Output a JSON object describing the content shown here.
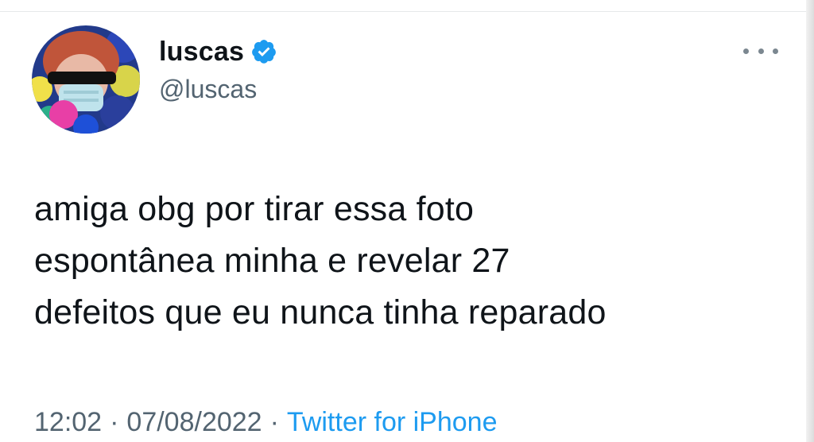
{
  "tweet": {
    "author": {
      "display_name": "luscas",
      "handle": "@luscas",
      "verified": true,
      "avatar_icon": "profile-photo"
    },
    "text": "amiga obg por tirar essa foto\nespontânea minha e revelar 27\ndefeitos que eu nunca tinha reparado",
    "time": "12:02",
    "date": "07/08/2022",
    "separator": "·",
    "source": "Twitter for iPhone",
    "more_icon": "more-horizontal-icon"
  },
  "colors": {
    "primary_text": "#0f1419",
    "secondary_text": "#536471",
    "link": "#1d9bf0",
    "verified_badge": "#1d9bf0"
  }
}
